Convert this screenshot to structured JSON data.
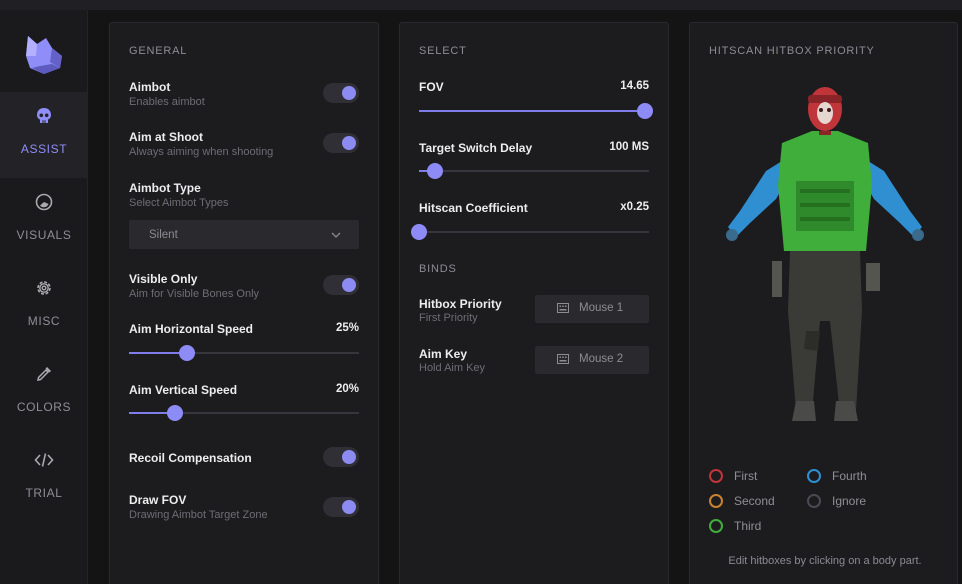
{
  "sidebar": {
    "items": [
      {
        "label": "ASSIST",
        "icon": "skull-icon",
        "active": true
      },
      {
        "label": "VISUALS",
        "icon": "visuals-icon",
        "active": false
      },
      {
        "label": "MISC",
        "icon": "gear-icon",
        "active": false
      },
      {
        "label": "COLORS",
        "icon": "eyedropper-icon",
        "active": false
      },
      {
        "label": "TRIAL",
        "icon": "code-icon",
        "active": false
      }
    ]
  },
  "general": {
    "title": "GENERAL",
    "aimbot": {
      "title": "Aimbot",
      "sub": "Enables aimbot",
      "enabled": true
    },
    "aim_at_shoot": {
      "title": "Aim at Shoot",
      "sub": "Always aiming when shooting",
      "enabled": true
    },
    "aimbot_type": {
      "title": "Aimbot Type",
      "sub": "Select Aimbot Types",
      "selected": "Silent"
    },
    "visible_only": {
      "title": "Visible Only",
      "sub": "Aim for Visible Bones Only",
      "enabled": true
    },
    "aim_h_speed": {
      "title": "Aim Horizontal Speed",
      "value": "25%",
      "fraction": 0.25
    },
    "aim_v_speed": {
      "title": "Aim Vertical Speed",
      "value": "20%",
      "fraction": 0.2
    },
    "recoil": {
      "title": "Recoil Compensation",
      "enabled": true
    },
    "draw_fov": {
      "title": "Draw FOV",
      "sub": "Drawing Aimbot Target Zone",
      "enabled": true
    }
  },
  "select": {
    "title": "SELECT",
    "fov": {
      "title": "FOV",
      "value": "14.65",
      "fraction": 1.0
    },
    "switch_delay": {
      "title": "Target Switch Delay",
      "value": "100 MS",
      "fraction": 0.07
    },
    "hitscan_coef": {
      "title": "Hitscan Coefficient",
      "value": "x0.25",
      "fraction": 0.0
    },
    "binds_title": "BINDS",
    "hitbox_priority": {
      "title": "Hitbox Priority",
      "sub": "First Priority",
      "key": "Mouse 1"
    },
    "aim_key": {
      "title": "Aim Key",
      "sub": "Hold Aim Key",
      "key": "Mouse 2"
    }
  },
  "hitbox": {
    "title": "HITSCAN HITBOX PRIORITY",
    "legend": [
      {
        "label": "First",
        "color": "#c0353a"
      },
      {
        "label": "Fourth",
        "color": "#2f8fd0"
      },
      {
        "label": "Second",
        "color": "#c98230"
      },
      {
        "label": "Ignore",
        "color": "#4a4a52"
      },
      {
        "label": "Third",
        "color": "#3fae3a"
      }
    ],
    "footnote": "Edit hitboxes by clicking on a body part."
  },
  "colors": {
    "accent": "#8c8bf2",
    "panel": "#1c1c1f",
    "background": "#141414"
  }
}
